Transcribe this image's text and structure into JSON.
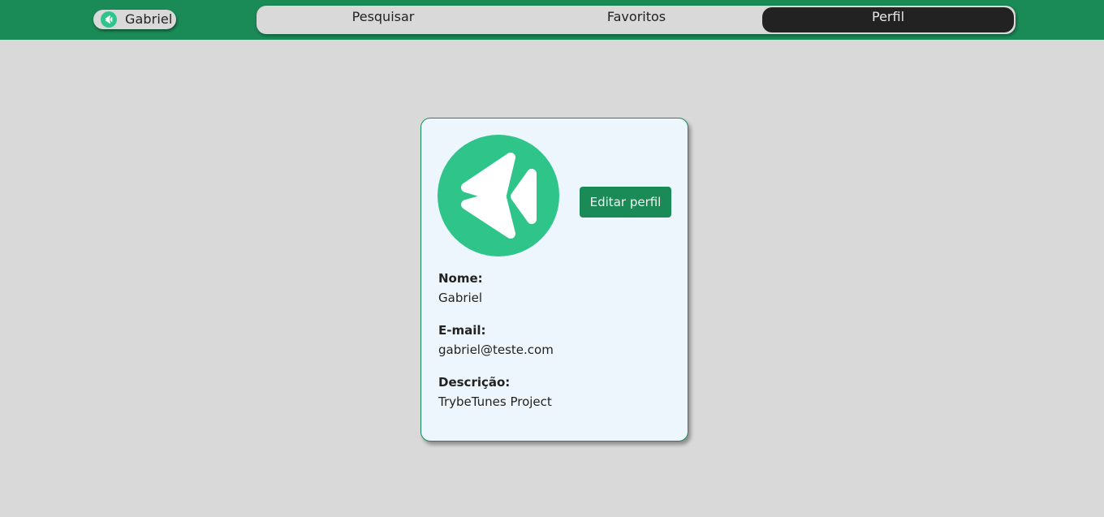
{
  "header": {
    "user_name": "Gabriel",
    "user_icon": "trybetunes-logo-icon",
    "brand_color": "#1a8a56"
  },
  "nav": {
    "tabs": [
      {
        "label": "Pesquisar",
        "active": false
      },
      {
        "label": "Favoritos",
        "active": false
      },
      {
        "label": "Perfil",
        "active": true
      }
    ]
  },
  "profile": {
    "avatar_icon": "trybetunes-logo-icon",
    "avatar_color": "#2fc58a",
    "edit_label": "Editar perfil",
    "fields": [
      {
        "label": "Nome:",
        "value": "Gabriel"
      },
      {
        "label": "E-mail:",
        "value": "gabriel@teste.com"
      },
      {
        "label": "Descrição:",
        "value": "TrybeTunes Project"
      }
    ]
  }
}
